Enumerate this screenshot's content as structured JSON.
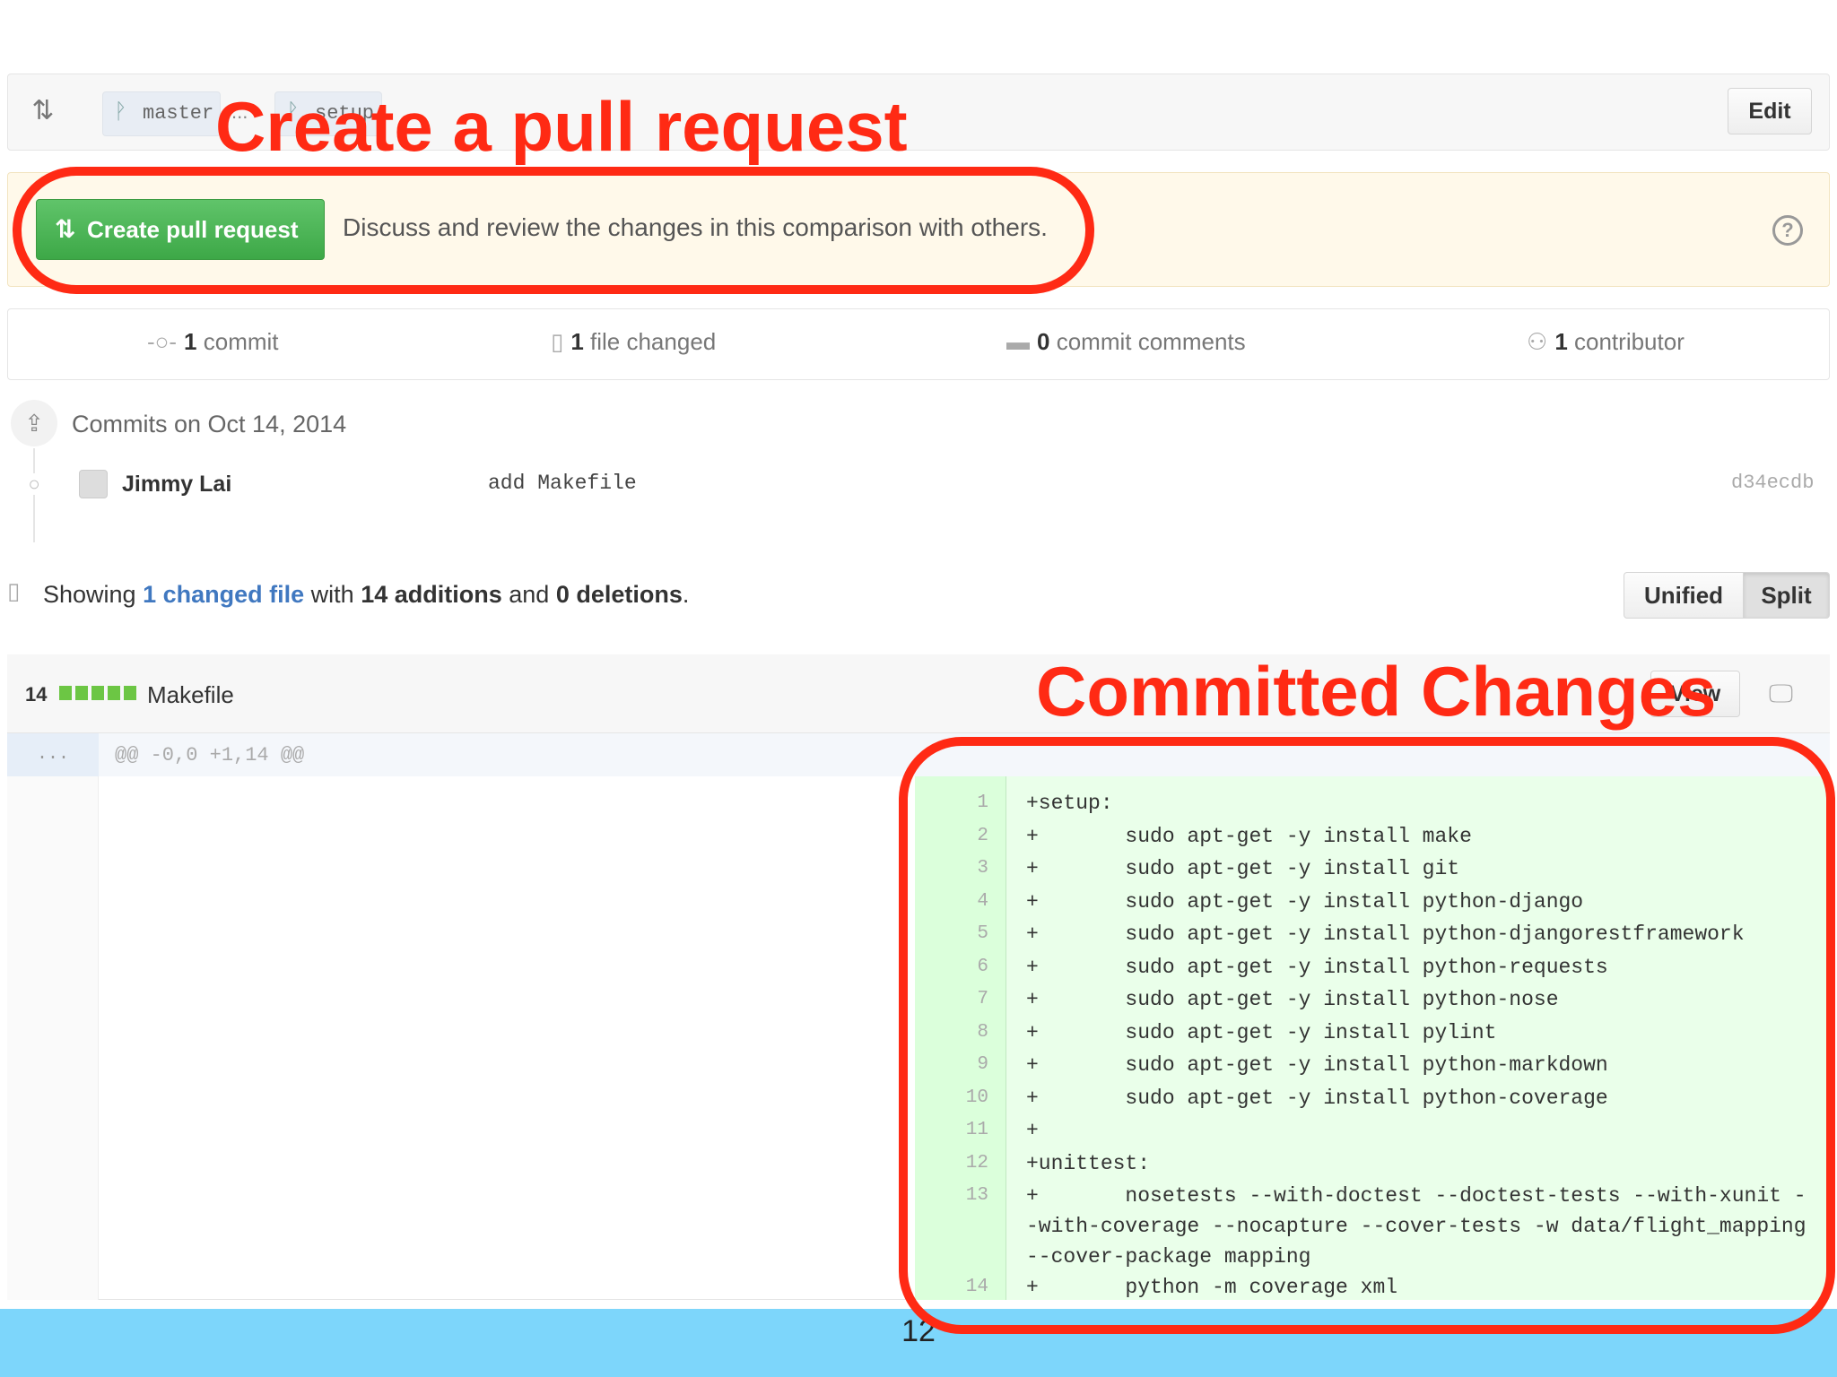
{
  "range": {
    "base_branch": "master",
    "dots": "...",
    "compare_branch": "setup",
    "edit_label": "Edit"
  },
  "banner": {
    "button_label": "Create pull request",
    "description": "Discuss and review the changes in this comparison with others."
  },
  "stats": {
    "commits_count": "1",
    "commits_label": "commit",
    "files_count": "1",
    "files_label": "file changed",
    "comments_count": "0",
    "comments_label": "commit comments",
    "contributors_count": "1",
    "contributors_label": "contributor"
  },
  "commits": {
    "date_heading": "Commits on Oct 14, 2014",
    "author": "Jimmy Lai",
    "message": "add Makefile",
    "sha": "d34ecdb"
  },
  "summary": {
    "prefix": "Showing",
    "changed_link": "1 changed file",
    "with": "with",
    "additions": "14 additions",
    "and": "and",
    "deletions": "0 deletions",
    "suffix": ".",
    "unified_label": "Unified",
    "split_label": "Split"
  },
  "file": {
    "changes": "14",
    "name": "Makefile",
    "view_label": "View",
    "hunk_gutter": "...",
    "hunk_header": "@@ -0,0 +1,14 @@",
    "lines": [
      {
        "n": "1",
        "text": "+setup:"
      },
      {
        "n": "2",
        "text": "+\tsudo apt-get -y install make"
      },
      {
        "n": "3",
        "text": "+\tsudo apt-get -y install git"
      },
      {
        "n": "4",
        "text": "+\tsudo apt-get -y install python-django"
      },
      {
        "n": "5",
        "text": "+\tsudo apt-get -y install python-djangorestframework"
      },
      {
        "n": "6",
        "text": "+\tsudo apt-get -y install python-requests"
      },
      {
        "n": "7",
        "text": "+\tsudo apt-get -y install python-nose"
      },
      {
        "n": "8",
        "text": "+\tsudo apt-get -y install pylint"
      },
      {
        "n": "9",
        "text": "+\tsudo apt-get -y install python-markdown"
      },
      {
        "n": "10",
        "text": "+\tsudo apt-get -y install python-coverage"
      },
      {
        "n": "11",
        "text": "+"
      },
      {
        "n": "12",
        "text": "+unittest:"
      },
      {
        "n": "13",
        "text": "+\tnosetests --with-doctest --doctest-tests --with-xunit --with-coverage --nocapture --cover-tests -w data/flight_mapping --cover-package mapping"
      },
      {
        "n": "14",
        "text": "+\tpython -m coverage xml"
      }
    ]
  },
  "annotations": {
    "title1": "Create a pull request",
    "title2": "Committed Changes"
  },
  "slide": {
    "page_number": "12"
  },
  "colors": {
    "annotation_red": "#ff2a14",
    "button_green": "#4bb653",
    "diff_green_bg": "#eaffea",
    "slide_bar_blue": "#7dd6fb",
    "link_blue": "#4078c0"
  },
  "icons": {
    "compare": "compare-icon",
    "branch": "branch-icon",
    "pull_request": "pull-request-icon",
    "help": "question-circle-icon",
    "commit": "commit-icon",
    "file_diff": "file-diff-icon",
    "comment": "comment-icon",
    "contributor": "organization-icon",
    "repo_push": "repo-push-icon",
    "desktop": "desktop-icon"
  }
}
